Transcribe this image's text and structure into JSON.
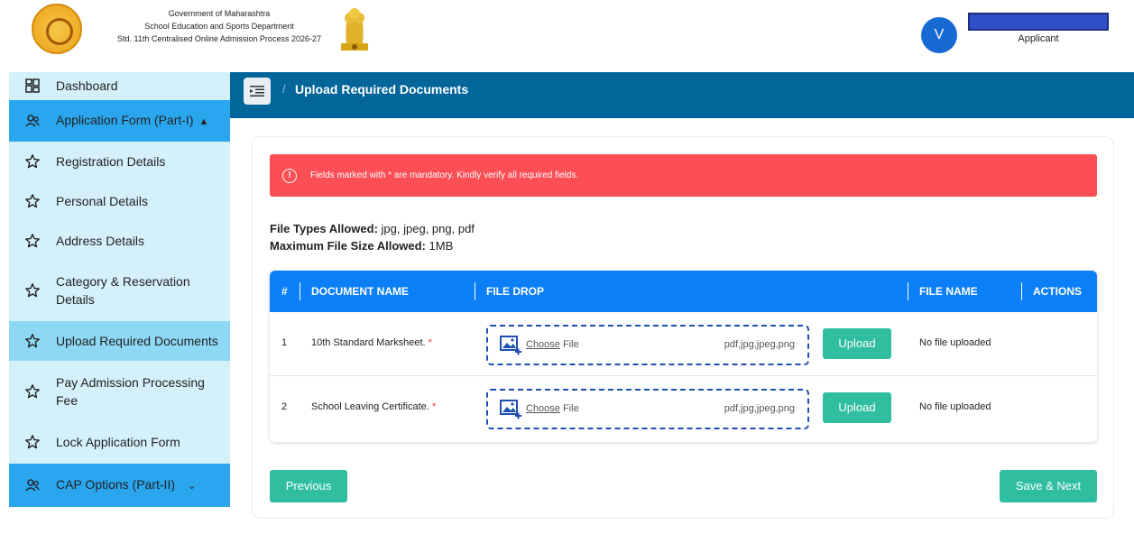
{
  "header": {
    "org_line1": "Government of Maharashtra",
    "org_line2": "School Education and Sports Department",
    "org_line3": "Std. 11th Centralised Online Admission Process 2026-27",
    "avatar_letter": "V",
    "user_role": "Applicant",
    "name_bar_color": "#2f4fc6"
  },
  "sidebar": {
    "items": [
      {
        "label": "Dashboard",
        "icon": "dashboard-icon"
      },
      {
        "label": "Application Form (Part-I)",
        "icon": "users-icon",
        "state": "expanded"
      },
      {
        "label": "Registration Details",
        "icon": "star-icon"
      },
      {
        "label": "Personal Details",
        "icon": "star-icon"
      },
      {
        "label": "Address Details",
        "icon": "star-icon"
      },
      {
        "label": "Category & Reservation Details",
        "icon": "star-icon"
      },
      {
        "label": "Upload Required Documents",
        "icon": "star-icon",
        "state": "active"
      },
      {
        "label": "Pay Admission Processing Fee",
        "icon": "star-icon"
      },
      {
        "label": "Lock Application Form",
        "icon": "star-icon"
      },
      {
        "label": "CAP Options (Part-II)",
        "icon": "users-icon",
        "state": "collapsed"
      }
    ]
  },
  "breadcrumb": {
    "separator": "/",
    "current": "Upload Required Documents"
  },
  "alert": {
    "text": "Fields marked with * are mandatory. Kindly verify all required fields.",
    "color": "#fb4e55"
  },
  "info": {
    "types_label": "File Types Allowed:",
    "types_value": "jpg, jpeg, png, pdf",
    "size_label": "Maximum File Size Allowed:",
    "size_value": "1MB"
  },
  "table": {
    "headers": [
      "#",
      "DOCUMENT NAME",
      "FILE DROP",
      "FILE NAME",
      "ACTIONS"
    ],
    "rows": [
      {
        "num": "1",
        "doc_name": "10th Standard Marksheet.",
        "required": "*",
        "choose_link": "Choose",
        "choose_rest": "File",
        "types": "pdf,jpg,jpeg,png",
        "upload_label": "Upload",
        "file_name": "No file uploaded"
      },
      {
        "num": "2",
        "doc_name": "School Leaving Certificate.",
        "required": "*",
        "choose_link": "Choose",
        "choose_rest": "File",
        "types": "pdf,jpg,jpeg,png",
        "upload_label": "Upload",
        "file_name": "No file uploaded"
      }
    ]
  },
  "footer": {
    "previous_label": "Previous",
    "next_label": "Save & Next"
  },
  "colors": {
    "accent": "#0a7ff7",
    "button": "#2fbfa0",
    "breadbar": "#02669a",
    "sidebar": "#d4f1fb"
  }
}
